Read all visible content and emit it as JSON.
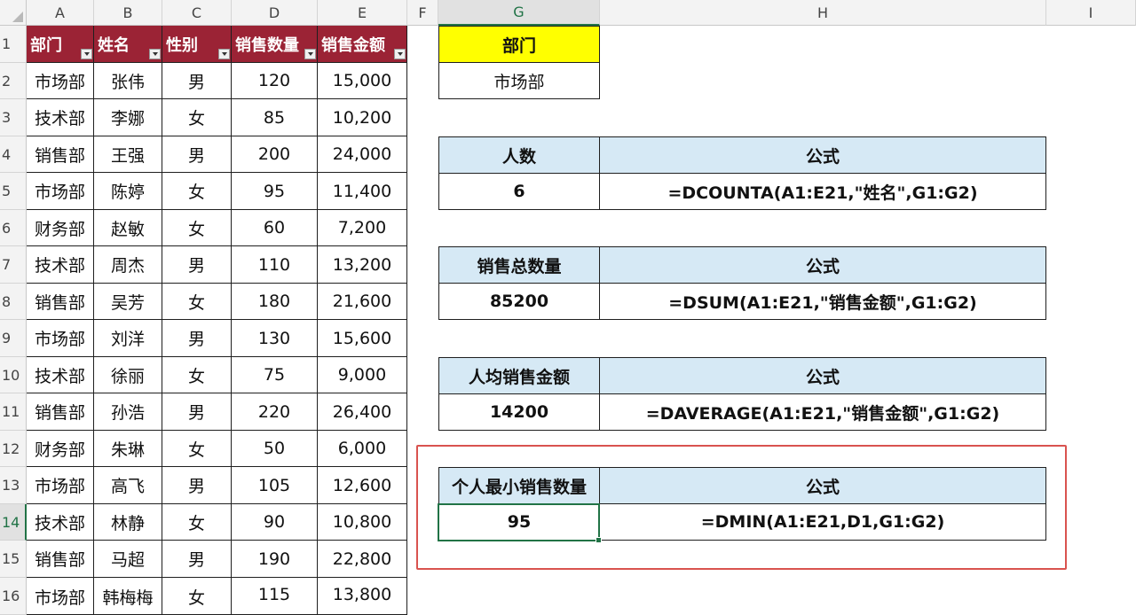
{
  "columns": [
    "A",
    "B",
    "C",
    "D",
    "E",
    "F",
    "G",
    "H",
    "I"
  ],
  "rows": [
    "1",
    "2",
    "3",
    "4",
    "5",
    "6",
    "7",
    "8",
    "9",
    "10",
    "11",
    "12",
    "13",
    "14",
    "15",
    "16"
  ],
  "headers": [
    "部门",
    "姓名",
    "性别",
    "销售数量",
    "销售金额"
  ],
  "data": [
    [
      "市场部",
      "张伟",
      "男",
      "120",
      "15,000"
    ],
    [
      "技术部",
      "李娜",
      "女",
      "85",
      "10,200"
    ],
    [
      "销售部",
      "王强",
      "男",
      "200",
      "24,000"
    ],
    [
      "市场部",
      "陈婷",
      "女",
      "95",
      "11,400"
    ],
    [
      "财务部",
      "赵敏",
      "女",
      "60",
      "7,200"
    ],
    [
      "技术部",
      "周杰",
      "男",
      "110",
      "13,200"
    ],
    [
      "销售部",
      "吴芳",
      "女",
      "180",
      "21,600"
    ],
    [
      "市场部",
      "刘洋",
      "男",
      "130",
      "15,600"
    ],
    [
      "技术部",
      "徐丽",
      "女",
      "75",
      "9,000"
    ],
    [
      "销售部",
      "孙浩",
      "男",
      "220",
      "26,400"
    ],
    [
      "财务部",
      "朱琳",
      "女",
      "50",
      "6,000"
    ],
    [
      "市场部",
      "高飞",
      "男",
      "105",
      "12,600"
    ],
    [
      "技术部",
      "林静",
      "女",
      "90",
      "10,800"
    ],
    [
      "销售部",
      "马超",
      "男",
      "190",
      "22,800"
    ],
    [
      "市场部",
      "韩梅梅",
      "女",
      "115",
      "13,800"
    ]
  ],
  "criteria": {
    "header": "部门",
    "value": "市场部"
  },
  "blocks": [
    {
      "label": "人数",
      "formula_label": "公式",
      "value": "6",
      "formula": "=DCOUNTA(A1:E21,\"姓名\",G1:G2)"
    },
    {
      "label": "销售总数量",
      "formula_label": "公式",
      "value": "85200",
      "formula": "=DSUM(A1:E21,\"销售金额\",G1:G2)"
    },
    {
      "label": "人均销售金额",
      "formula_label": "公式",
      "value": "14200",
      "formula": "=DAVERAGE(A1:E21,\"销售金额\",G1:G2)"
    },
    {
      "label": "个人最小销售数量",
      "formula_label": "公式",
      "value": "95",
      "formula": "=DMIN(A1:E21,D1,G1:G2)"
    }
  ],
  "colors": {
    "header_fill": "#9b2335",
    "criteria_fill": "#ffff00",
    "block_fill": "#d6e9f5",
    "highlight_frame": "#d9534f",
    "selection": "#217346"
  }
}
